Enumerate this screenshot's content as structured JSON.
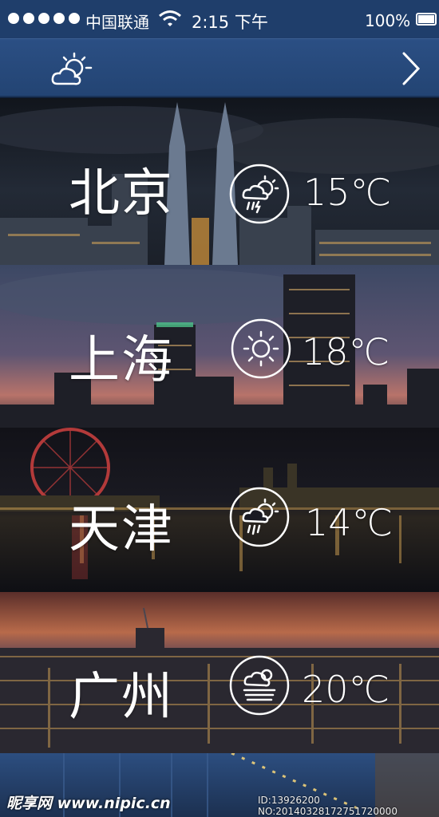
{
  "status_bar": {
    "carrier": "中国联通",
    "time": "2:15 下午",
    "battery": "100%",
    "signal_bars": 5
  },
  "nav": {
    "left_icon": "weather-icon",
    "right_icon": "chevron-right-icon"
  },
  "cities": [
    {
      "name": "北京",
      "temp": "15℃",
      "icon": "thunder-rain-icon"
    },
    {
      "name": "上海",
      "temp": "18℃",
      "icon": "sunny-icon"
    },
    {
      "name": "天津",
      "temp": "14℃",
      "icon": "rain-icon"
    },
    {
      "name": "广州",
      "temp": "20℃",
      "icon": "haze-icon"
    }
  ],
  "watermark": {
    "site": "昵享网 www.nipic.cn",
    "id": "ID:13926200 NO:20140328172751720000"
  }
}
